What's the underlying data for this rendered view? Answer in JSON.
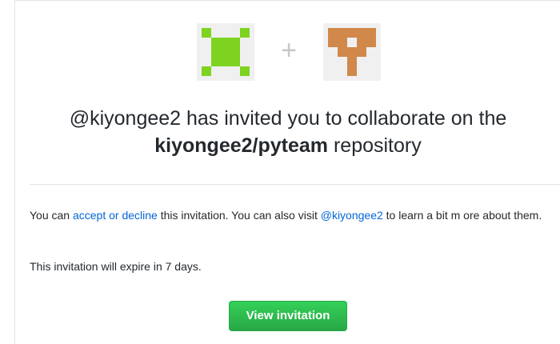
{
  "avatars": {
    "inviter": {
      "icon": "identicon-inviter-icon",
      "color": "#7ed321",
      "background": "#f0f0f0"
    },
    "repository": {
      "icon": "identicon-repository-icon",
      "color": "#d1884b",
      "background": "#f0f0f0"
    },
    "separator": "+"
  },
  "headline": {
    "line_1": "@kiyongee2 has invited you to collaborate on the",
    "repo_name": "kiyongee2/pyteam",
    "line_2_suffix": " repository"
  },
  "message": {
    "part_1": "You can ",
    "accept_decline_link": "accept or decline",
    "part_2": " this invitation. You can also visit ",
    "profile_link": "@kiyongee2",
    "part_3": " to learn a bit m ore about them.",
    "expiry": "This invitation will expire in 7 days."
  },
  "button": {
    "label": "View invitation",
    "color": "#28a745"
  },
  "colors": {
    "link": "#0366d6",
    "text": "#24292e",
    "divider": "#e1e4e8"
  }
}
